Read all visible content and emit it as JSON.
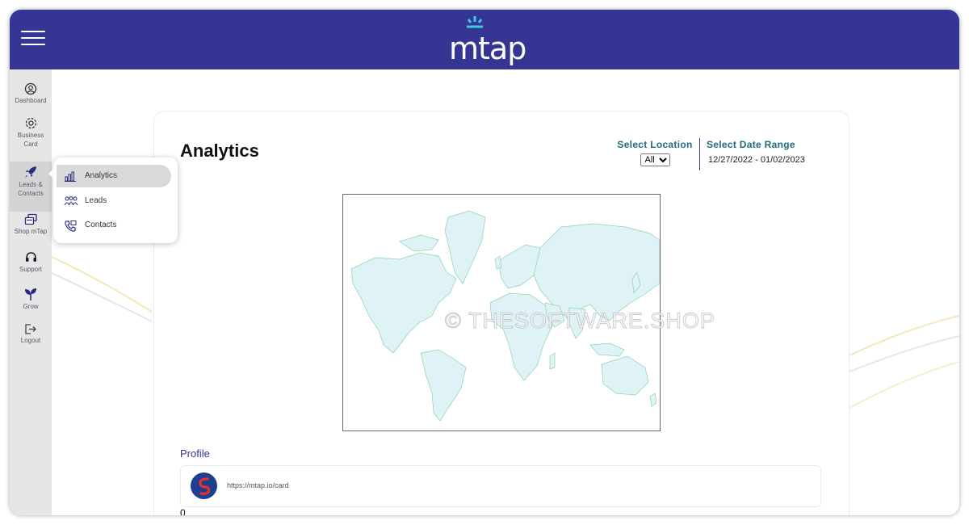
{
  "header": {
    "logo_text": "mtap"
  },
  "sidebar": {
    "items": [
      {
        "label": "Dashboard",
        "icon": "user-circle-icon"
      },
      {
        "label": "Business Card",
        "icon": "gear-icon"
      },
      {
        "label": "Leads & Contacts",
        "icon": "rocket-icon"
      },
      {
        "label": "Shop mTap",
        "icon": "cards-icon"
      },
      {
        "label": "Support",
        "icon": "headset-icon"
      },
      {
        "label": "Grow",
        "icon": "sprout-icon"
      },
      {
        "label": "Logout",
        "icon": "logout-icon"
      }
    ]
  },
  "flyout": {
    "items": [
      {
        "label": "Analytics",
        "icon": "bar-chart-icon"
      },
      {
        "label": "Leads",
        "icon": "people-icon"
      },
      {
        "label": "Contacts",
        "icon": "phone-book-icon"
      }
    ]
  },
  "main": {
    "title": "Analytics",
    "location": {
      "label": "Select Location",
      "selected": "All"
    },
    "date_range": {
      "label": "Select Date Range",
      "value": "12/27/2022 - 01/02/2023"
    },
    "watermark": "© THESOFTWARE.SHOP",
    "profile": {
      "title": "Profile",
      "url": "https://mtap.io/card",
      "count": "0"
    }
  },
  "colors": {
    "header": "#353594",
    "accent_teal": "#1e6b7a",
    "sidebar": "#e6e6e6",
    "map_land": "#dff2f5",
    "map_border": "#8fd1b0"
  }
}
